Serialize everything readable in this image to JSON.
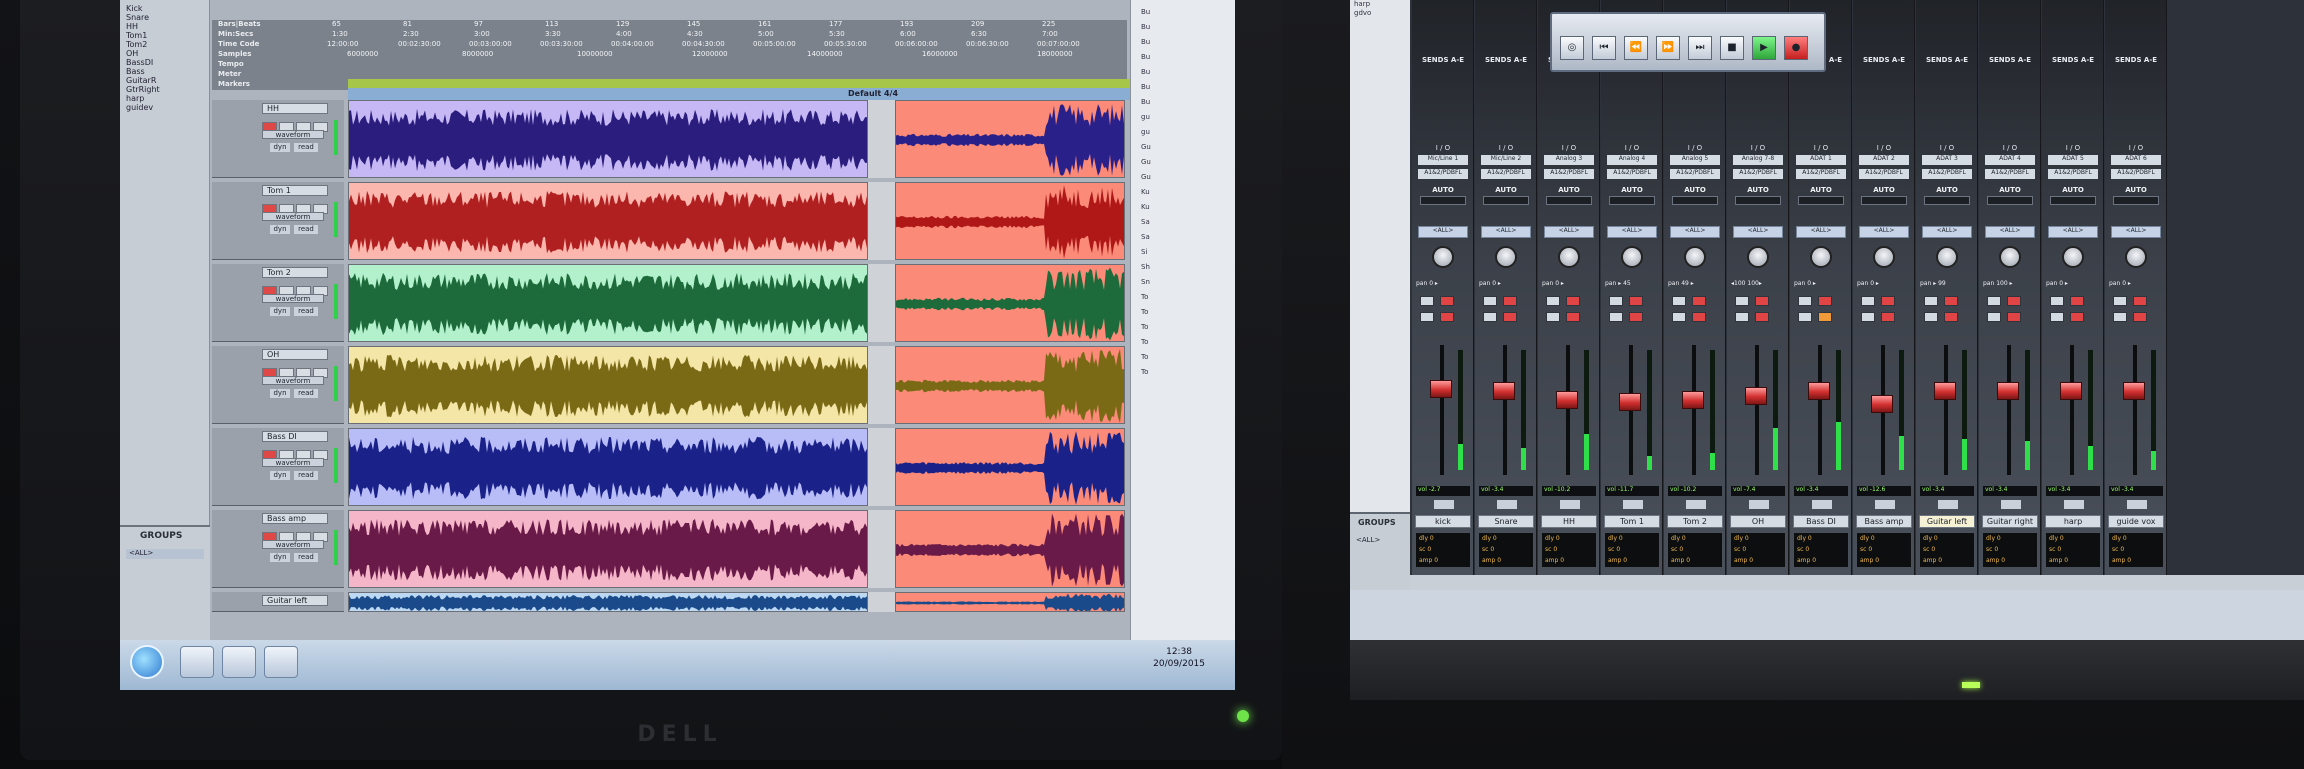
{
  "left_screen": {
    "tracklist": [
      "Kick",
      "Snare",
      "HH",
      "Tom1",
      "Tom2",
      "OH",
      "BassDI",
      "Bass",
      "GuitarR",
      "GtrRight",
      "harp",
      "guidev"
    ],
    "groups_title": "GROUPS",
    "groups_all": "<ALL>",
    "rulers": {
      "labels": [
        "Bars|Beats",
        "Min:Secs",
        "Time Code",
        "Samples",
        "Tempo",
        "Meter",
        "Markers"
      ],
      "bars": [
        "65",
        "81",
        "97",
        "113",
        "129",
        "145",
        "161",
        "177",
        "193",
        "209",
        "225"
      ],
      "minsecs": [
        "1:30",
        "2:30",
        "3:00",
        "3:30",
        "4:00",
        "4:30",
        "5:00",
        "5:30",
        "6:00",
        "6:30",
        "7:00"
      ],
      "timecode": [
        "12:00:00",
        "00:02:30:00",
        "00:03:00:00",
        "00:03:30:00",
        "00:04:00:00",
        "00:04:30:00",
        "00:05:00:00",
        "00:05:30:00",
        "00:06:00:00",
        "00:06:30:00",
        "00:07:00:00"
      ],
      "samples": [
        "6000000",
        "8000000",
        "10000000",
        "12000000",
        "14000000",
        "16000000",
        "18000000"
      ],
      "meter": "Default 4/4"
    },
    "tracks": [
      {
        "name": "HH",
        "view": "waveform",
        "dyn": "dyn",
        "read": "read",
        "color": "#c6b8f4",
        "wave": "#2b1d7d",
        "rcolor": "#fb8a78",
        "rwave": "#29208a"
      },
      {
        "name": "Tom 1",
        "view": "waveform",
        "dyn": "dyn",
        "read": "read",
        "color": "#fbb6ae",
        "wave": "#b02020",
        "rcolor": "#fb8a78",
        "rwave": "#b01818"
      },
      {
        "name": "Tom 2",
        "view": "waveform",
        "dyn": "dyn",
        "read": "read",
        "color": "#b3f0cc",
        "wave": "#1d6a3a",
        "rcolor": "#fb8a78",
        "rwave": "#1d6a3a"
      },
      {
        "name": "OH",
        "view": "waveform",
        "dyn": "dyn",
        "read": "read",
        "color": "#f3e6a6",
        "wave": "#7a6a16",
        "rcolor": "#fb8a78",
        "rwave": "#7a6a16"
      },
      {
        "name": "Bass DI",
        "view": "waveform",
        "dyn": "dyn",
        "read": "read",
        "color": "#b8bcf7",
        "wave": "#1a228a",
        "rcolor": "#fb8a78",
        "rwave": "#1a228a"
      },
      {
        "name": "Bass amp",
        "view": "waveform",
        "dyn": "dyn",
        "read": "read",
        "color": "#f4b6c8",
        "wave": "#6a1a48",
        "rcolor": "#fb8a78",
        "rwave": "#6a1a48"
      },
      {
        "name": "Guitar left",
        "view": "",
        "dyn": "",
        "read": "",
        "color": "#bcd8f2",
        "wave": "#1a4a8a",
        "rcolor": "#fb8a78",
        "rwave": "#1a4a8a"
      }
    ],
    "browser_items": [
      "Bu",
      "Bu",
      "Bu",
      "Bu",
      "Bu",
      "Bu",
      "Bu",
      "gu",
      "gu",
      "Gu",
      "Gu",
      "Gu",
      "Ku",
      "Ku",
      "Sa",
      "Sa",
      "Si",
      "Sh",
      "Sn",
      "To",
      "To",
      "To",
      "To",
      "To",
      "To"
    ],
    "taskbar": {
      "time": "12:38",
      "date": "20/09/2015"
    },
    "monitor_brand": "DELL"
  },
  "right_screen": {
    "transport_buttons": [
      "◎",
      "⏮",
      "⏪",
      "⏩",
      "⏭",
      "■",
      "▶",
      "●"
    ],
    "sends_label": "SENDS A-E",
    "io_label": "I / O",
    "auto_label": "AUTO",
    "group_label": "<ALL>",
    "left_list": [
      "harp",
      "gdvo"
    ],
    "groups_title": "GROUPS",
    "groups_all": "<ALL>",
    "strips": [
      {
        "name": "kick",
        "in": "Mic/Line 1",
        "out": "A1&2/PDBFL",
        "pan": "pan  0 ▸",
        "vol": "vol  -2.7",
        "fader": 0.68,
        "level": 0.22,
        "hl": false
      },
      {
        "name": "Snare",
        "in": "Mic/Line 2",
        "out": "A1&2/PDBFL",
        "pan": "pan  0 ▸",
        "vol": "vol  -3.4",
        "fader": 0.66,
        "level": 0.18,
        "hl": false
      },
      {
        "name": "HH",
        "in": "Analog 3",
        "out": "A1&2/PDBFL",
        "pan": "pan  0 ▸",
        "vol": "vol  -10.2",
        "fader": 0.58,
        "level": 0.3,
        "hl": false
      },
      {
        "name": "Tom 1",
        "in": "Analog 4",
        "out": "A1&2/PDBFL",
        "pan": "pan  ▸ 45",
        "vol": "vol  -11.7",
        "fader": 0.56,
        "level": 0.12,
        "hl": false
      },
      {
        "name": "Tom 2",
        "in": "Analog 5",
        "out": "A1&2/PDBFL",
        "pan": "pan  49 ▸",
        "vol": "vol  -10.2",
        "fader": 0.58,
        "level": 0.14,
        "hl": false
      },
      {
        "name": "OH",
        "in": "Analog 7-8",
        "out": "A1&2/PDBFL",
        "pan": "◂100 100▸",
        "vol": "vol  -7.4",
        "fader": 0.62,
        "level": 0.35,
        "hl": false
      },
      {
        "name": "Bass DI",
        "in": "ADAT 1",
        "out": "A1&2/PDBFL",
        "pan": "pan  0 ▸",
        "vol": "vol  -3.4",
        "fader": 0.66,
        "level": 0.4,
        "hl": false
      },
      {
        "name": "Bass amp",
        "in": "ADAT 2",
        "out": "A1&2/PDBFL",
        "pan": "pan  0 ▸",
        "vol": "vol  -12.6",
        "fader": 0.55,
        "level": 0.28,
        "hl": false
      },
      {
        "name": "Guitar left",
        "in": "ADAT 3",
        "out": "A1&2/PDBFL",
        "pan": "pan  ▸ 99",
        "vol": "vol  -3.4",
        "fader": 0.66,
        "level": 0.26,
        "hl": true
      },
      {
        "name": "Guitar right",
        "in": "ADAT 4",
        "out": "A1&2/PDBFL",
        "pan": "pan  100 ▸",
        "vol": "vol  -3.4",
        "fader": 0.66,
        "level": 0.24,
        "hl": false
      },
      {
        "name": "harp",
        "in": "ADAT 5",
        "out": "A1&2/PDBFL",
        "pan": "pan  0 ▸",
        "vol": "vol  -3.4",
        "fader": 0.66,
        "level": 0.2,
        "hl": false
      },
      {
        "name": "guide vox",
        "in": "ADAT 6",
        "out": "A1&2/PDBFL",
        "pan": "pan  0 ▸",
        "vol": "vol  -3.4",
        "fader": 0.66,
        "level": 0.16,
        "hl": false
      }
    ],
    "foot_lines": [
      "dly   0",
      "sc     0",
      "amp   0"
    ]
  }
}
